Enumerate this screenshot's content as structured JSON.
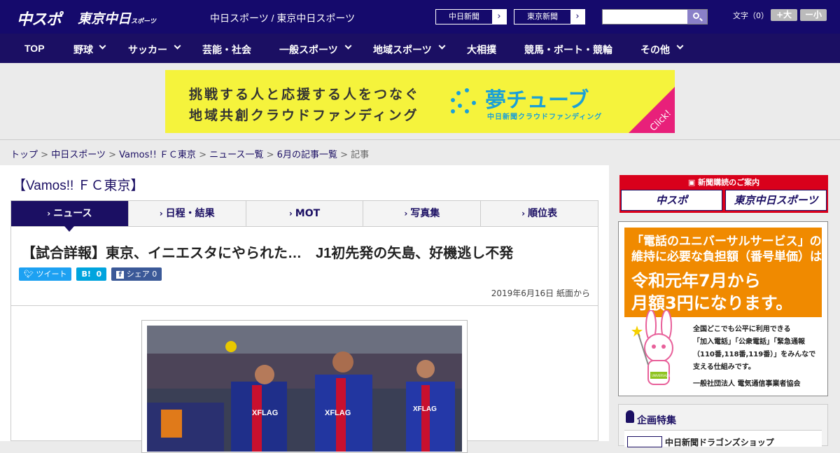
{
  "header": {
    "logo_chuspo": "中スポ",
    "logo_tokyo": "東京中日",
    "logo_tokyo_small": "スポーツ",
    "sites": "中日スポーツ / 東京中日スポーツ",
    "paper_links": [
      {
        "label": "中日新聞"
      },
      {
        "label": "東京新聞"
      }
    ],
    "search_placeholder": "",
    "font_label": "文字（0）",
    "font_plus": "+大",
    "font_minus": "ー小"
  },
  "nav": {
    "items": [
      {
        "label": "TOP",
        "has_dropdown": false
      },
      {
        "label": "野球",
        "has_dropdown": true
      },
      {
        "label": "サッカー",
        "has_dropdown": true
      },
      {
        "label": "芸能・社会",
        "has_dropdown": false
      },
      {
        "label": "一般スポーツ",
        "has_dropdown": true
      },
      {
        "label": "地域スポーツ",
        "has_dropdown": true
      },
      {
        "label": "大相撲",
        "has_dropdown": false
      },
      {
        "label": "競馬・ボート・競輪",
        "has_dropdown": false
      },
      {
        "label": "その他",
        "has_dropdown": true
      }
    ]
  },
  "ad": {
    "line1": "挑戦する人と応援する人をつなぐ",
    "line2": "地域共創クラウドファンディング",
    "brand": "夢チューブ",
    "sub": "中日新聞クラウドファンディング",
    "click": "Click!"
  },
  "breadcrumb": {
    "items": [
      "トップ",
      "中日スポーツ",
      "Vamos!! ＦＣ東京",
      "ニュース一覧",
      "6月の記事一覧"
    ],
    "current": "記事",
    "separator": ">"
  },
  "section": {
    "title": "【Vamos!! ＦＣ東京】"
  },
  "tabs": [
    {
      "label": "ニュース",
      "active": true
    },
    {
      "label": "日程・結果",
      "active": false
    },
    {
      "label": "MOT",
      "active": false
    },
    {
      "label": "写真集",
      "active": false
    },
    {
      "label": "順位表",
      "active": false
    }
  ],
  "article": {
    "headline": "【試合詳報】東京、イニエスタにやられた…　J1初先発の矢島、好機逃し不発",
    "share": {
      "tweet": "ツイート",
      "hatena": "B!",
      "hatena_count": "0",
      "fb": "シェア",
      "fb_count": "0"
    },
    "date": "2019年6月16日 紙面から"
  },
  "sidebar": {
    "subscribe_title": "新聞購読のご案内",
    "subscribe_buttons": [
      "中スポ",
      "東京中日スポーツ"
    ],
    "notice": {
      "h1": "「電話のユニバーサルサービス」の",
      "h2": "維持に必要な負担額（番号単価）は",
      "big1": "令和元年7月から",
      "big2": "月額3円になります。",
      "t1": "全国どこでも公平に利用できる",
      "t2": "「加入電話」「公衆電話」「緊急通報",
      "t3": "（110番,118番,119番）」をみんなで",
      "t4": "支える仕組みです。",
      "org": "一般社団法人 電気通信事業者協会",
      "badge": "UNIVERSAL SERVICE"
    },
    "feature_title": "企画特集",
    "feature_item": "中日新聞ドラゴンズショップ"
  },
  "colors": {
    "navy": "#150a6c",
    "nav": "#1b0f63",
    "twitter": "#1da1f2",
    "hatena": "#00a4de",
    "facebook": "#3b5998",
    "ad_yellow": "#f5f33c",
    "ad_blue": "#1aa0d8",
    "red": "#d9001b",
    "orange": "#f08a00"
  }
}
